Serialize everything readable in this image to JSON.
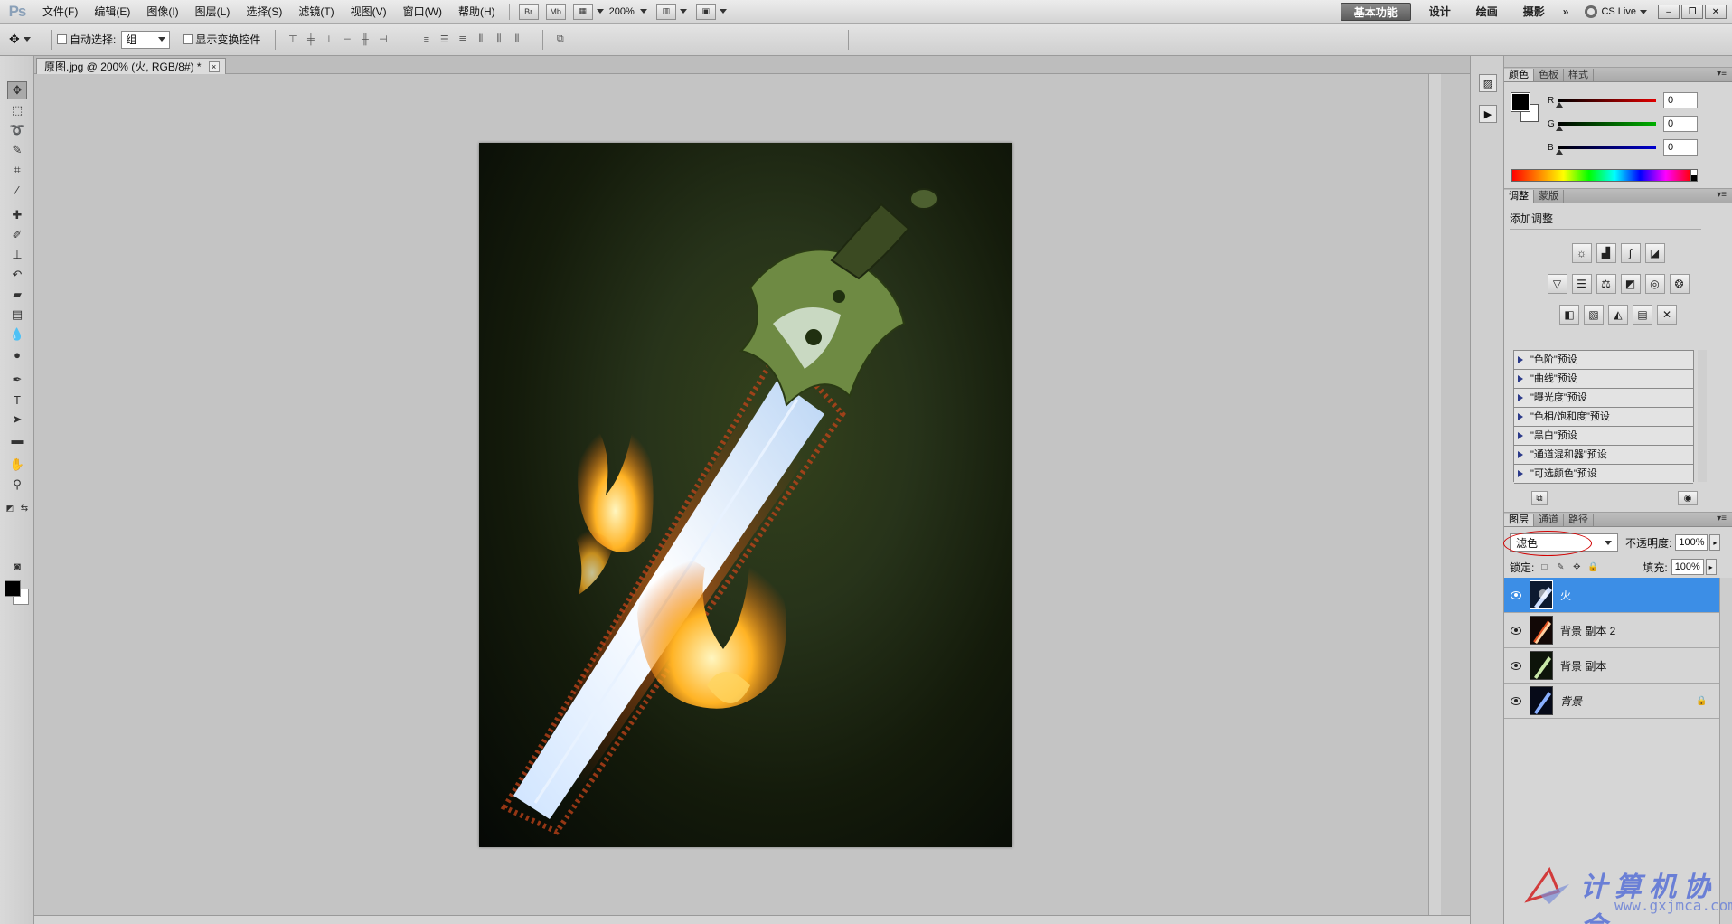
{
  "app": {
    "logo": "Ps"
  },
  "menu": [
    "文件(F)",
    "编辑(E)",
    "图像(I)",
    "图层(L)",
    "选择(S)",
    "滤镜(T)",
    "视图(V)",
    "窗口(W)",
    "帮助(H)"
  ],
  "app_bar": {
    "bridge": "Br",
    "mini_bridge": "Mb",
    "zoom": "200%"
  },
  "workspaces": [
    "基本功能",
    "设计",
    "绘画",
    "摄影"
  ],
  "workspace_more": "»",
  "cs_live": "CS Live",
  "options_bar": {
    "auto_select_label": "自动选择:",
    "auto_select_value": "组",
    "show_transform_label": "显示变换控件"
  },
  "document": {
    "tab_title": "原图.jpg @ 200% (火, RGB/8#) *",
    "tab_close": "×"
  },
  "color_panel": {
    "tabs": [
      "颜色",
      "色板",
      "样式"
    ],
    "sliders": [
      {
        "label": "R",
        "value": "0",
        "color": "#e00000"
      },
      {
        "label": "G",
        "value": "0",
        "color": "#00b000"
      },
      {
        "label": "B",
        "value": "0",
        "color": "#0000d0"
      }
    ]
  },
  "adjustments_panel": {
    "tabs": [
      "调整",
      "蒙版"
    ],
    "title": "添加调整",
    "presets": [
      "\"色阶\"预设",
      "\"曲线\"预设",
      "\"曝光度\"预设",
      "\"色相/饱和度\"预设",
      "\"黑白\"预设",
      "\"通道混和器\"预设",
      "\"可选颜色\"预设"
    ]
  },
  "layers_panel": {
    "tabs": [
      "图层",
      "通道",
      "路径"
    ],
    "blend_mode": "滤色",
    "opacity_label": "不透明度:",
    "opacity_value": "100%",
    "lock_label": "锁定:",
    "fill_label": "填充:",
    "fill_value": "100%",
    "layers": [
      {
        "name": "火",
        "selected": true,
        "locked": false
      },
      {
        "name": "背景 副本 2",
        "selected": false,
        "locked": false
      },
      {
        "name": "背景 副本",
        "selected": false,
        "locked": false
      },
      {
        "name": "背景",
        "selected": false,
        "locked": true
      }
    ]
  },
  "watermark": {
    "title": "计算机协会",
    "url": "www.gxjmca.com"
  },
  "colors": {
    "selection": "#3c8ee6",
    "annotation": "#d10000"
  }
}
